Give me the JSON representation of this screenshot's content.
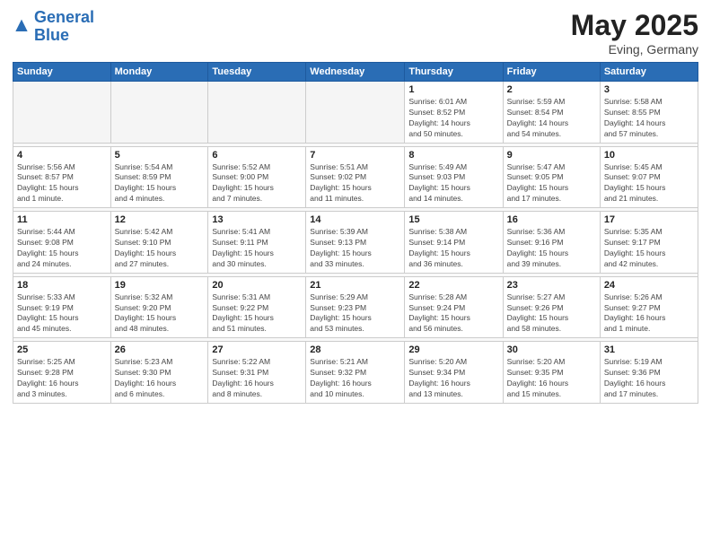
{
  "logo": {
    "line1": "General",
    "line2": "Blue"
  },
  "title": "May 2025",
  "subtitle": "Eving, Germany",
  "days": [
    "Sunday",
    "Monday",
    "Tuesday",
    "Wednesday",
    "Thursday",
    "Friday",
    "Saturday"
  ],
  "weeks": [
    [
      {
        "day": "",
        "info": ""
      },
      {
        "day": "",
        "info": ""
      },
      {
        "day": "",
        "info": ""
      },
      {
        "day": "",
        "info": ""
      },
      {
        "day": "1",
        "info": "Sunrise: 6:01 AM\nSunset: 8:52 PM\nDaylight: 14 hours\nand 50 minutes."
      },
      {
        "day": "2",
        "info": "Sunrise: 5:59 AM\nSunset: 8:54 PM\nDaylight: 14 hours\nand 54 minutes."
      },
      {
        "day": "3",
        "info": "Sunrise: 5:58 AM\nSunset: 8:55 PM\nDaylight: 14 hours\nand 57 minutes."
      }
    ],
    [
      {
        "day": "4",
        "info": "Sunrise: 5:56 AM\nSunset: 8:57 PM\nDaylight: 15 hours\nand 1 minute."
      },
      {
        "day": "5",
        "info": "Sunrise: 5:54 AM\nSunset: 8:59 PM\nDaylight: 15 hours\nand 4 minutes."
      },
      {
        "day": "6",
        "info": "Sunrise: 5:52 AM\nSunset: 9:00 PM\nDaylight: 15 hours\nand 7 minutes."
      },
      {
        "day": "7",
        "info": "Sunrise: 5:51 AM\nSunset: 9:02 PM\nDaylight: 15 hours\nand 11 minutes."
      },
      {
        "day": "8",
        "info": "Sunrise: 5:49 AM\nSunset: 9:03 PM\nDaylight: 15 hours\nand 14 minutes."
      },
      {
        "day": "9",
        "info": "Sunrise: 5:47 AM\nSunset: 9:05 PM\nDaylight: 15 hours\nand 17 minutes."
      },
      {
        "day": "10",
        "info": "Sunrise: 5:45 AM\nSunset: 9:07 PM\nDaylight: 15 hours\nand 21 minutes."
      }
    ],
    [
      {
        "day": "11",
        "info": "Sunrise: 5:44 AM\nSunset: 9:08 PM\nDaylight: 15 hours\nand 24 minutes."
      },
      {
        "day": "12",
        "info": "Sunrise: 5:42 AM\nSunset: 9:10 PM\nDaylight: 15 hours\nand 27 minutes."
      },
      {
        "day": "13",
        "info": "Sunrise: 5:41 AM\nSunset: 9:11 PM\nDaylight: 15 hours\nand 30 minutes."
      },
      {
        "day": "14",
        "info": "Sunrise: 5:39 AM\nSunset: 9:13 PM\nDaylight: 15 hours\nand 33 minutes."
      },
      {
        "day": "15",
        "info": "Sunrise: 5:38 AM\nSunset: 9:14 PM\nDaylight: 15 hours\nand 36 minutes."
      },
      {
        "day": "16",
        "info": "Sunrise: 5:36 AM\nSunset: 9:16 PM\nDaylight: 15 hours\nand 39 minutes."
      },
      {
        "day": "17",
        "info": "Sunrise: 5:35 AM\nSunset: 9:17 PM\nDaylight: 15 hours\nand 42 minutes."
      }
    ],
    [
      {
        "day": "18",
        "info": "Sunrise: 5:33 AM\nSunset: 9:19 PM\nDaylight: 15 hours\nand 45 minutes."
      },
      {
        "day": "19",
        "info": "Sunrise: 5:32 AM\nSunset: 9:20 PM\nDaylight: 15 hours\nand 48 minutes."
      },
      {
        "day": "20",
        "info": "Sunrise: 5:31 AM\nSunset: 9:22 PM\nDaylight: 15 hours\nand 51 minutes."
      },
      {
        "day": "21",
        "info": "Sunrise: 5:29 AM\nSunset: 9:23 PM\nDaylight: 15 hours\nand 53 minutes."
      },
      {
        "day": "22",
        "info": "Sunrise: 5:28 AM\nSunset: 9:24 PM\nDaylight: 15 hours\nand 56 minutes."
      },
      {
        "day": "23",
        "info": "Sunrise: 5:27 AM\nSunset: 9:26 PM\nDaylight: 15 hours\nand 58 minutes."
      },
      {
        "day": "24",
        "info": "Sunrise: 5:26 AM\nSunset: 9:27 PM\nDaylight: 16 hours\nand 1 minute."
      }
    ],
    [
      {
        "day": "25",
        "info": "Sunrise: 5:25 AM\nSunset: 9:28 PM\nDaylight: 16 hours\nand 3 minutes."
      },
      {
        "day": "26",
        "info": "Sunrise: 5:23 AM\nSunset: 9:30 PM\nDaylight: 16 hours\nand 6 minutes."
      },
      {
        "day": "27",
        "info": "Sunrise: 5:22 AM\nSunset: 9:31 PM\nDaylight: 16 hours\nand 8 minutes."
      },
      {
        "day": "28",
        "info": "Sunrise: 5:21 AM\nSunset: 9:32 PM\nDaylight: 16 hours\nand 10 minutes."
      },
      {
        "day": "29",
        "info": "Sunrise: 5:20 AM\nSunset: 9:34 PM\nDaylight: 16 hours\nand 13 minutes."
      },
      {
        "day": "30",
        "info": "Sunrise: 5:20 AM\nSunset: 9:35 PM\nDaylight: 16 hours\nand 15 minutes."
      },
      {
        "day": "31",
        "info": "Sunrise: 5:19 AM\nSunset: 9:36 PM\nDaylight: 16 hours\nand 17 minutes."
      }
    ]
  ]
}
